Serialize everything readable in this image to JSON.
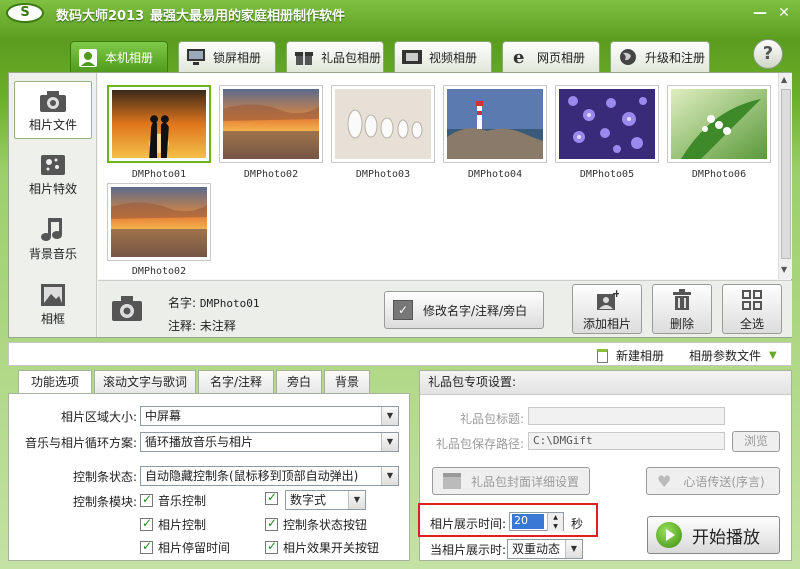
{
  "window": {
    "app_name": "数码大师2013",
    "slogan": "最强大最易用的家庭相册制作软件",
    "minimize": "—",
    "close": "✕"
  },
  "tabs": [
    {
      "label": "本机相册",
      "icon": "person-icon",
      "active": true
    },
    {
      "label": "锁屏相册",
      "icon": "monitor-icon"
    },
    {
      "label": "礼品包相册",
      "icon": "gift-icon"
    },
    {
      "label": "视频相册",
      "icon": "film-icon"
    },
    {
      "label": "网页相册",
      "icon": "ie-icon"
    },
    {
      "label": "升级和注册",
      "icon": "globe-icon"
    }
  ],
  "help": "?",
  "sidebar": [
    {
      "label": "相片文件",
      "icon": "camera-icon",
      "active": true
    },
    {
      "label": "相片特效",
      "icon": "sparkle-icon"
    },
    {
      "label": "背景音乐",
      "icon": "music-note-icon"
    },
    {
      "label": "相框",
      "icon": "picture-frame-icon"
    }
  ],
  "photos": [
    {
      "name": "DMPhoto01",
      "scene": "sunset-couple",
      "selected": true
    },
    {
      "name": "DMPhoto02",
      "scene": "sunset-sea"
    },
    {
      "name": "DMPhoto03",
      "scene": "sand-footprints"
    },
    {
      "name": "DMPhoto04",
      "scene": "lighthouse"
    },
    {
      "name": "DMPhoto05",
      "scene": "purple-flowers"
    },
    {
      "name": "DMPhoto06",
      "scene": "lily-of-valley"
    },
    {
      "name": "DMPhoto02",
      "scene": "sunset-sea"
    }
  ],
  "info": {
    "name_label": "名字:",
    "name_value": "DMPhoto01",
    "note_label": "注释:",
    "note_value": "未注释"
  },
  "buttons": {
    "edit": "修改名字/注释/旁白",
    "add": "添加相片",
    "delete": "删除",
    "select_all": "全选"
  },
  "toolbar2": {
    "new_album": "新建相册",
    "album_params": "相册参数文件"
  },
  "lower_tabs": [
    "功能选项",
    "滚动文字与歌词",
    "名字/注释",
    "旁白",
    "背景"
  ],
  "options": {
    "area_size_label": "相片区域大小:",
    "area_size_value": "中屏幕",
    "loop_label": "音乐与相片循环方案:",
    "loop_value": "循环播放音乐与相片",
    "control_label": "控制条状态:",
    "control_value": "自动隐藏控制条(鼠标移到顶部自动弹出)",
    "module_label": "控制条模块:",
    "checks": [
      "音乐控制",
      "相片控制",
      "相片停留时间",
      "控制条状态按钮",
      "相片效果开关按钮"
    ],
    "number_style": "数字式"
  },
  "gift": {
    "title": "礼品包专项设置:",
    "pkg_title_label": "礼品包标题:",
    "pkg_title_value": "",
    "save_path_label": "礼品包保存路径:",
    "save_path_value": "C:\\DMGift",
    "browse": "浏览",
    "cover_btn": "礼品包封面详细设置",
    "message_btn": "心语传送(序言)"
  },
  "display": {
    "time_label": "相片展示时间:",
    "time_value": "20",
    "unit": "秒",
    "when_label": "当相片展示时:",
    "when_value": "双重动态"
  },
  "play": "开始播放"
}
